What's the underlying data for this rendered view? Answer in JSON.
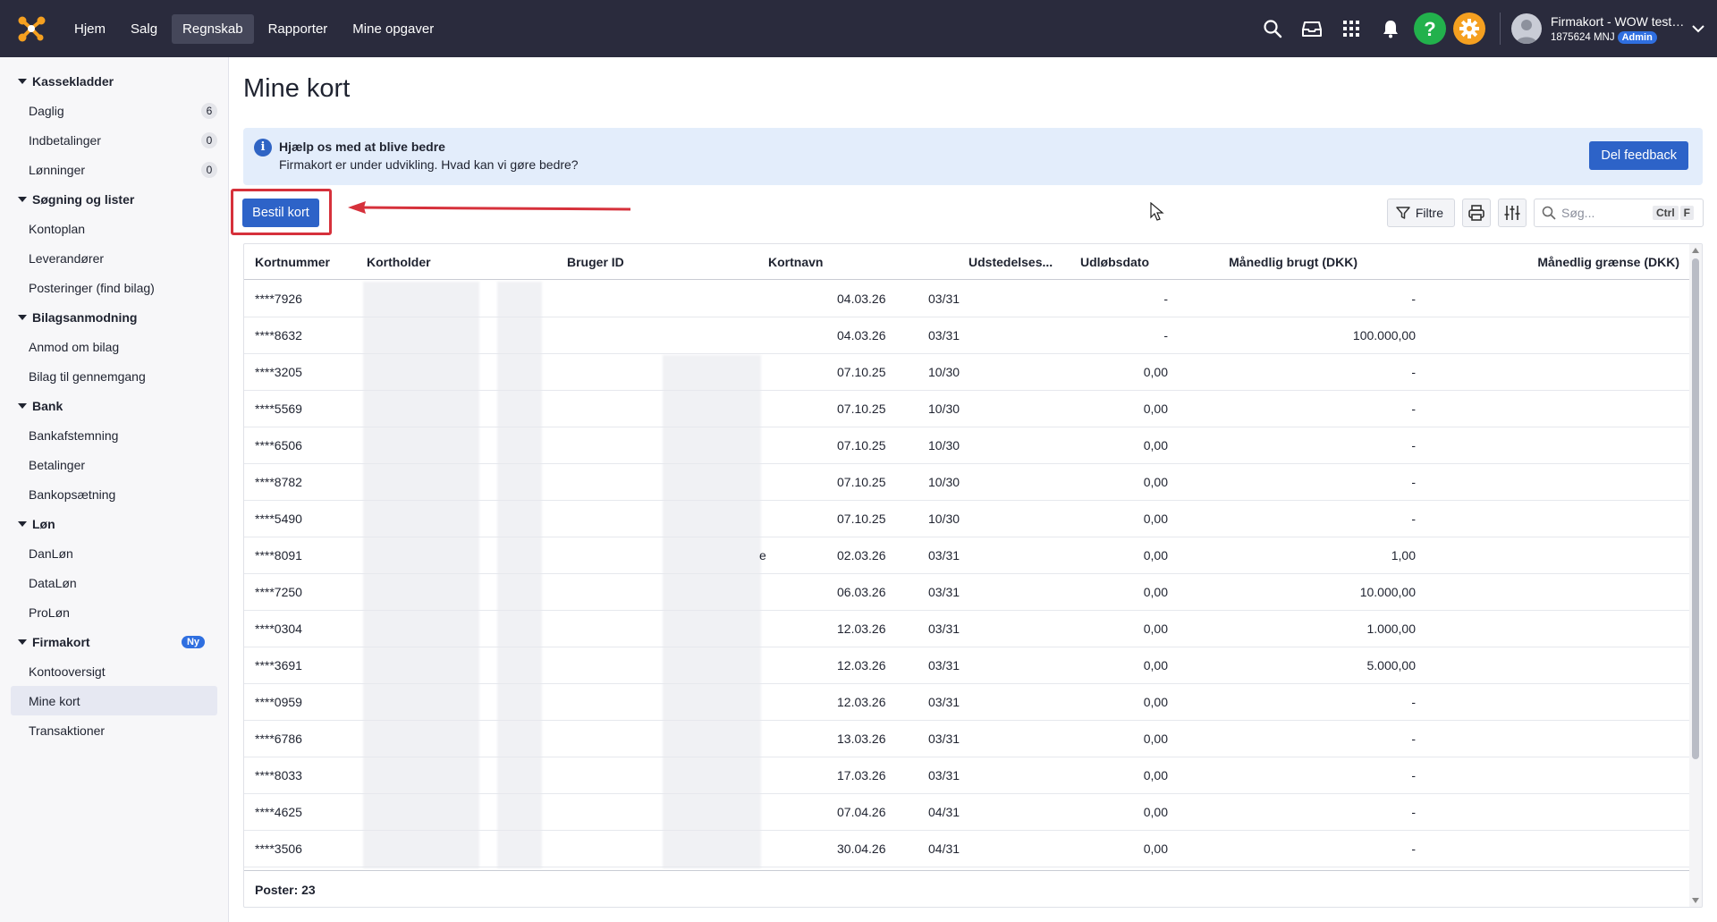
{
  "nav": {
    "items": [
      {
        "label": "Hjem",
        "active": false
      },
      {
        "label": "Salg",
        "active": false
      },
      {
        "label": "Regnskab",
        "active": true
      },
      {
        "label": "Rapporter",
        "active": false
      },
      {
        "label": "Mine opgaver",
        "active": false
      }
    ]
  },
  "account": {
    "company": "Firmakort - WOW test ...",
    "id": "1875624 MNJ",
    "role": "Admin"
  },
  "sidebar": {
    "sections": [
      {
        "title": "Kassekladder",
        "badge": null,
        "items": [
          {
            "label": "Daglig",
            "count": "6"
          },
          {
            "label": "Indbetalinger",
            "count": "0"
          },
          {
            "label": "Lønninger",
            "count": "0"
          }
        ]
      },
      {
        "title": "Søgning og lister",
        "badge": null,
        "items": [
          {
            "label": "Kontoplan"
          },
          {
            "label": "Leverandører"
          },
          {
            "label": "Posteringer (find bilag)"
          }
        ]
      },
      {
        "title": "Bilagsanmodning",
        "badge": null,
        "items": [
          {
            "label": "Anmod om bilag"
          },
          {
            "label": "Bilag til gennemgang"
          }
        ]
      },
      {
        "title": "Bank",
        "badge": null,
        "items": [
          {
            "label": "Bankafstemning"
          },
          {
            "label": "Betalinger"
          },
          {
            "label": "Bankopsætning"
          }
        ]
      },
      {
        "title": "Løn",
        "badge": null,
        "items": [
          {
            "label": "DanLøn"
          },
          {
            "label": "DataLøn"
          },
          {
            "label": "ProLøn"
          }
        ]
      },
      {
        "title": "Firmakort",
        "badge": "Ny",
        "items": [
          {
            "label": "Kontooversigt"
          },
          {
            "label": "Mine kort",
            "active": true
          },
          {
            "label": "Transaktioner"
          }
        ]
      }
    ]
  },
  "page": {
    "title": "Mine kort"
  },
  "banner": {
    "title": "Hjælp os med at blive bedre",
    "subtitle": "Firmakort er under udvikling. Hvad kan vi gøre bedre?",
    "button": "Del feedback"
  },
  "actions": {
    "order_card": "Bestil kort",
    "filter": "Filtre",
    "search_placeholder": "Søg...",
    "shortcut_ctrl": "Ctrl",
    "shortcut_key": "F"
  },
  "table": {
    "columns": [
      "Kortnummer",
      "Kortholder",
      "Bruger ID",
      "Kortnavn",
      "Udstedelses...",
      "Udløbsdato",
      "Månedlig brugt (DKK)",
      "Månedlig grænse (DKK)"
    ],
    "rows": [
      {
        "card": "****7926",
        "name_suffix": "",
        "issued": "04.03.26",
        "expires": "03/31",
        "used": "-",
        "limit": "-"
      },
      {
        "card": "****8632",
        "name_suffix": "",
        "issued": "04.03.26",
        "expires": "03/31",
        "used": "-",
        "limit": "100.000,00"
      },
      {
        "card": "****3205",
        "name_suffix": "",
        "issued": "07.10.25",
        "expires": "10/30",
        "used": "0,00",
        "limit": "-"
      },
      {
        "card": "****5569",
        "name_suffix": "",
        "issued": "07.10.25",
        "expires": "10/30",
        "used": "0,00",
        "limit": "-"
      },
      {
        "card": "****6506",
        "name_suffix": "",
        "issued": "07.10.25",
        "expires": "10/30",
        "used": "0,00",
        "limit": "-"
      },
      {
        "card": "****8782",
        "name_suffix": "",
        "issued": "07.10.25",
        "expires": "10/30",
        "used": "0,00",
        "limit": "-"
      },
      {
        "card": "****5490",
        "name_suffix": "",
        "issued": "07.10.25",
        "expires": "10/30",
        "used": "0,00",
        "limit": "-"
      },
      {
        "card": "****8091",
        "name_suffix": "e",
        "issued": "02.03.26",
        "expires": "03/31",
        "used": "0,00",
        "limit": "1,00"
      },
      {
        "card": "****7250",
        "name_suffix": "",
        "issued": "06.03.26",
        "expires": "03/31",
        "used": "0,00",
        "limit": "10.000,00"
      },
      {
        "card": "****0304",
        "name_suffix": "",
        "issued": "12.03.26",
        "expires": "03/31",
        "used": "0,00",
        "limit": "1.000,00"
      },
      {
        "card": "****3691",
        "name_suffix": "",
        "issued": "12.03.26",
        "expires": "03/31",
        "used": "0,00",
        "limit": "5.000,00"
      },
      {
        "card": "****0959",
        "name_suffix": "",
        "issued": "12.03.26",
        "expires": "03/31",
        "used": "0,00",
        "limit": "-"
      },
      {
        "card": "****6786",
        "name_suffix": "",
        "issued": "13.03.26",
        "expires": "03/31",
        "used": "0,00",
        "limit": "-"
      },
      {
        "card": "****8033",
        "name_suffix": "",
        "issued": "17.03.26",
        "expires": "03/31",
        "used": "0,00",
        "limit": "-"
      },
      {
        "card": "****4625",
        "name_suffix": "",
        "issued": "07.04.26",
        "expires": "04/31",
        "used": "0,00",
        "limit": "-"
      },
      {
        "card": "****3506",
        "name_suffix": "",
        "issued": "30.04.26",
        "expires": "04/31",
        "used": "0,00",
        "limit": "-"
      }
    ],
    "footer": "Poster: 23"
  },
  "colors": {
    "topbar": "#2a2b3d",
    "primary": "#2d63c8",
    "help": "#22b14c",
    "settings": "#f5a020",
    "highlight": "#d6313b",
    "banner_bg": "#e3edfb"
  }
}
